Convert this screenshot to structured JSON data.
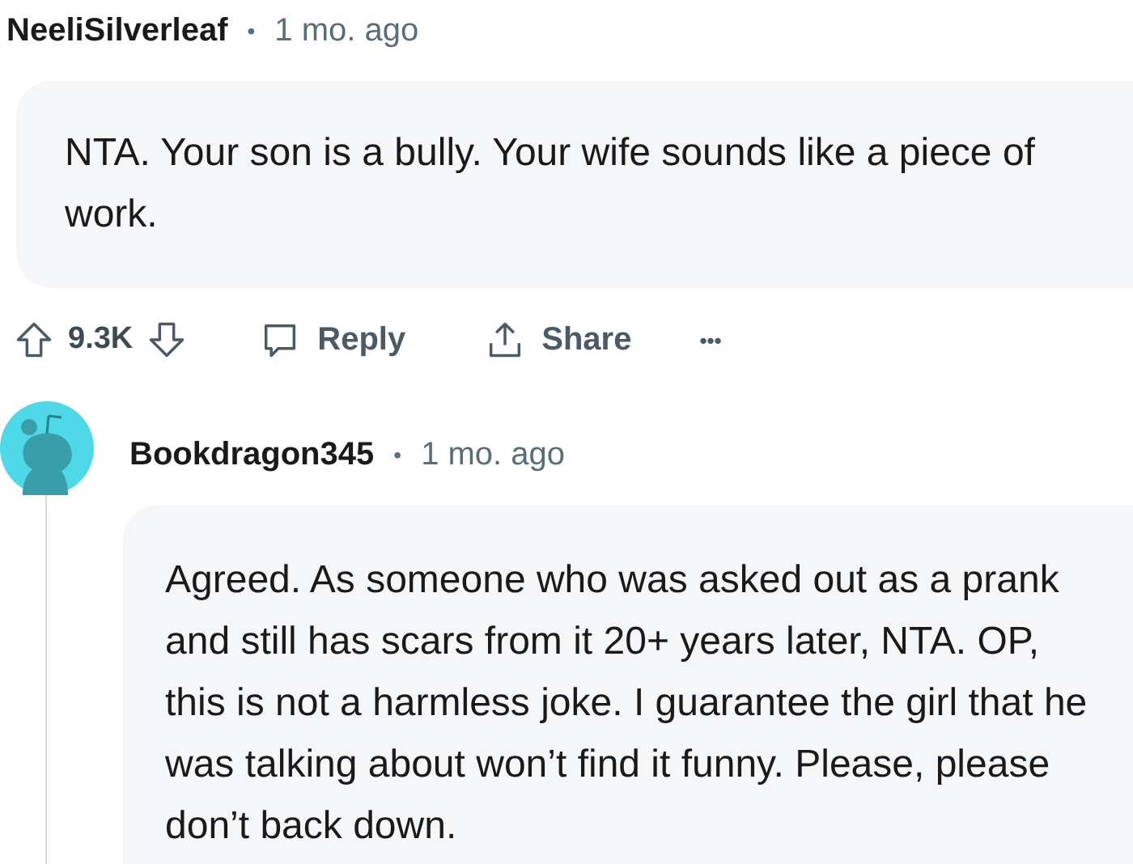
{
  "comments": [
    {
      "author": "NeeliSilverleaf",
      "separator": "•",
      "time": "1 mo. ago",
      "body": "NTA. Your son is a bully. Your wife sounds like a piece of work.",
      "has_avatar": false,
      "actions": {
        "votes": "9.3K",
        "reply": "Reply",
        "share": "Share",
        "more": "•••"
      }
    },
    {
      "author": "Bookdragon345",
      "separator": "•",
      "time": "1 mo. ago",
      "body": "Agreed. As someone who was asked out as a prank and still has scars from it 20+ years later, NTA. OP, this is not a harmless joke. I guarantee the girl that he was talking about won’t find it funny. Please, please don’t back down.",
      "has_avatar": true
    }
  ]
}
